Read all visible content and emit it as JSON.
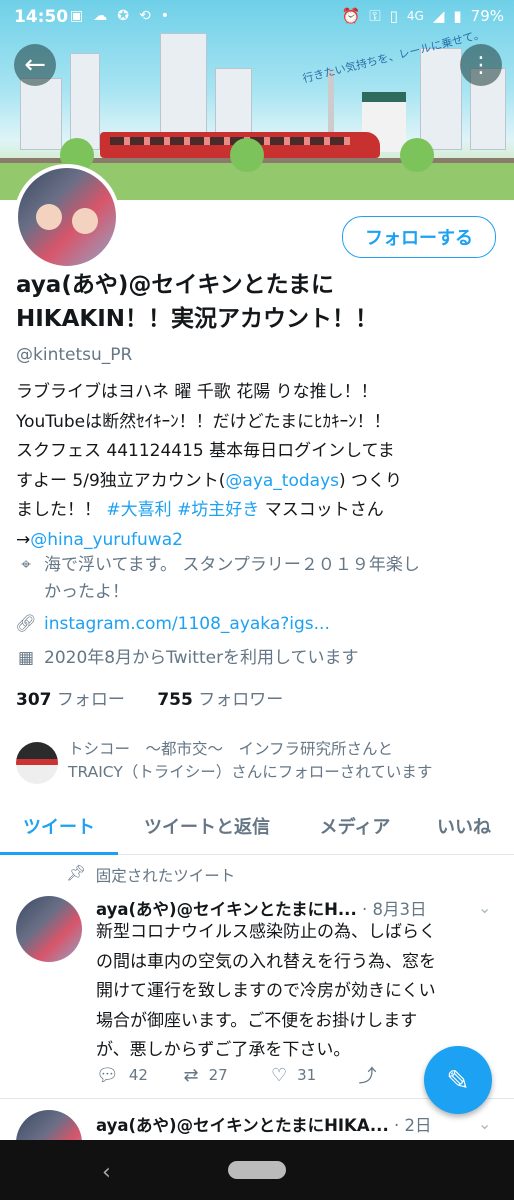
{
  "status_bar": {
    "time": "14:50",
    "network": "4G",
    "battery": "79%",
    "left_icons": [
      "gallery-icon",
      "cloud-icon",
      "app-icon",
      "sync-icon",
      "dot-icon"
    ],
    "right_icons": [
      "alarm-icon",
      "key-icon",
      "vibrate-icon",
      "signal-icon",
      "battery-icon"
    ]
  },
  "banner": {
    "slogan": "行きたい気持ちを、レールに乗せて。"
  },
  "profile": {
    "follow_label": "フォローする",
    "name_line1": "aya(あや)@セイキンとたまに",
    "name_line2": "HIKAKIN！！実況アカウント！！",
    "handle": "@kintetsu_PR",
    "bio": {
      "line1": "ラブライブはヨハネ 曜 千歌 花陽 りな推し！！",
      "line2": "YouTubeは断然ｾｲｷｰﾝ！！だけどたまにﾋｶｷｰﾝ！！",
      "line3": "スクフェス 441124415 基本毎日ログインしてま",
      "line4_pre": "すよー 5/9独立アカウント(",
      "line4_link": "@aya_todays",
      "line4_post": ") つくり",
      "line5_pre": "ました！！ ",
      "tag1": "#大喜利",
      "tag2": "#坊主好き",
      "line5_post": " マスコットさん",
      "line6_pre": "→",
      "line6_link": "@hina_yurufuwa2"
    },
    "location_line1": "海で浮いてます。 スタンプラリー２０１９年楽し",
    "location_line2": "かったよ！",
    "website": "instagram.com/1108_ayaka?igs...",
    "joined": "2020年8月からTwitterを利用しています",
    "following_count": "307",
    "following_label": "フォロー",
    "followers_count": "755",
    "followers_label": "フォロワー",
    "followed_by_line1": "トシコー　～都市交～　インフラ研究所さんと",
    "followed_by_line2": "TRAICY（トライシー）さんにフォローされています"
  },
  "tabs": [
    {
      "label": "ツイート"
    },
    {
      "label": "ツイートと返信"
    },
    {
      "label": "メディア"
    },
    {
      "label": "いいね"
    }
  ],
  "pinned_label": "固定されたツイート",
  "tweets": [
    {
      "name": "aya(あや)@セイキンとたまにH...",
      "date": "· 8月3日",
      "lines": [
        "新型コロナウイルス感染防止の為、しばらく",
        "の間は車内の空気の入れ替えを行う為、窓を",
        "開けて運行を致しますので冷房が効きにくい",
        "場合が御座います。ご不便をお掛けします",
        "が、悪しからずご了承を下さい。"
      ],
      "replies": "42",
      "retweets": "27",
      "likes": "31"
    },
    {
      "name": "aya(あや)@セイキンとたまにHIKA...",
      "date": "· 2日"
    }
  ],
  "colors": {
    "accent": "#1da1f2",
    "text": "#14171a",
    "secondary": "#657786"
  }
}
